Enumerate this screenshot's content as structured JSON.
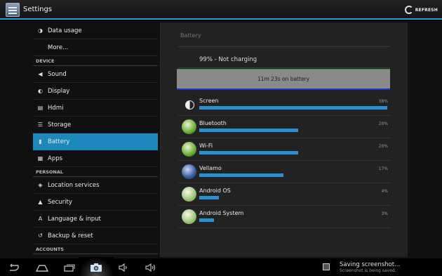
{
  "action_bar": {
    "title": "Settings",
    "refresh_label": "REFRESH"
  },
  "sidebar": {
    "items": [
      {
        "type": "item",
        "label": "Data usage",
        "icon": "data-usage-icon"
      },
      {
        "type": "item",
        "label": "More...",
        "icon": ""
      },
      {
        "type": "header",
        "label": "DEVICE"
      },
      {
        "type": "item",
        "label": "Sound",
        "icon": "speaker-icon"
      },
      {
        "type": "item",
        "label": "Display",
        "icon": "display-icon"
      },
      {
        "type": "item",
        "label": "Hdmi",
        "icon": "hdmi-icon"
      },
      {
        "type": "item",
        "label": "Storage",
        "icon": "storage-icon"
      },
      {
        "type": "item",
        "label": "Battery",
        "icon": "battery-icon",
        "selected": true
      },
      {
        "type": "item",
        "label": "Apps",
        "icon": "apps-icon"
      },
      {
        "type": "header",
        "label": "PERSONAL"
      },
      {
        "type": "item",
        "label": "Location services",
        "icon": "location-icon"
      },
      {
        "type": "item",
        "label": "Security",
        "icon": "lock-icon"
      },
      {
        "type": "item",
        "label": "Language & input",
        "icon": "keyboard-icon"
      },
      {
        "type": "item",
        "label": "Backup & reset",
        "icon": "backup-icon"
      },
      {
        "type": "header",
        "label": "ACCOUNTS"
      }
    ]
  },
  "battery": {
    "title": "Battery",
    "status": "99% - Not charging",
    "graph_label": "11m 23s on battery",
    "usage": [
      {
        "name": "Screen",
        "percent_label": "38%",
        "percent": 38,
        "icon": "screen-icon"
      },
      {
        "name": "Bluetooth",
        "percent_label": "20%",
        "percent": 20,
        "icon": "bluetooth-icon"
      },
      {
        "name": "Wi-Fi",
        "percent_label": "20%",
        "percent": 20,
        "icon": "wifi-icon"
      },
      {
        "name": "Vellamo",
        "percent_label": "17%",
        "percent": 17,
        "icon": "vellamo-app-icon"
      },
      {
        "name": "Android OS",
        "percent_label": "4%",
        "percent": 4,
        "icon": "android-os-icon"
      },
      {
        "name": "Android System",
        "percent_label": "3%",
        "percent": 3,
        "icon": "android-system-icon"
      }
    ]
  },
  "navbar": {
    "buttons": [
      "back-icon",
      "home-icon",
      "recent-apps-icon",
      "camera-icon",
      "volume-down-icon",
      "volume-up-icon"
    ]
  },
  "notification": {
    "title": "Saving screenshot...",
    "subtitle": "Screenshot is being saved."
  },
  "colors": {
    "accent": "#1d88bb",
    "bar": "#2e8fd0",
    "graph_line": "#1c3ad0"
  }
}
